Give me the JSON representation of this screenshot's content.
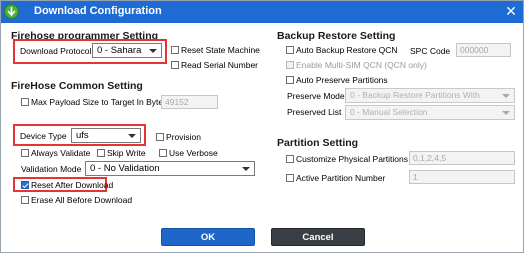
{
  "window": {
    "title": "Download Configuration",
    "close_glyph": "✕"
  },
  "firehose_programmer": {
    "heading": "Firehose programmer Setting",
    "protocol_label": "Download Protocol",
    "protocol_value": "0 - Sahara",
    "reset_state_machine": {
      "label": "Reset State Machine",
      "checked": false
    },
    "read_serial_number": {
      "label": "Read Serial Number",
      "checked": false
    }
  },
  "firehose_common": {
    "heading": "FireHose Common Setting",
    "max_payload": {
      "label": "Max Payload Size to Target In Byte",
      "checked": false,
      "value": "49152"
    },
    "device_type_label": "Device Type",
    "device_type_value": "ufs",
    "provision": {
      "label": "Provision",
      "checked": false
    },
    "always_validate": {
      "label": "Always Validate",
      "checked": false
    },
    "skip_write": {
      "label": "Skip Write",
      "checked": false
    },
    "use_verbose": {
      "label": "Use Verbose",
      "checked": false
    },
    "validation_mode_label": "Validation Mode",
    "validation_mode_value": "0 - No Validation",
    "reset_after_download": {
      "label": "Reset After Download",
      "checked": true
    },
    "erase_all_before_download": {
      "label": "Erase All Before Download",
      "checked": false
    }
  },
  "backup_restore": {
    "heading": "Backup Restore Setting",
    "auto_backup_restore_qcn": {
      "label": "Auto Backup Restore QCN",
      "checked": false
    },
    "spc_code_label": "SPC Code",
    "spc_code_value": "000000",
    "enable_multi_sim": {
      "label": "Enable Multi-SIM QCN (QCN only)",
      "checked": false
    },
    "auto_preserve_partitions": {
      "label": "Auto Preserve Partitions",
      "checked": false
    },
    "preserve_mode_label": "Preserve Mode",
    "preserve_mode_value": "0 - Backup Restore Partitions With",
    "preserved_list_label": "Preserved List",
    "preserved_list_value": "0 - Manual Selection"
  },
  "partition": {
    "heading": "Partition Setting",
    "customize_physical_partitions": {
      "label": "Customize Physical Partitions",
      "checked": false,
      "value": "0,1,2,4,5"
    },
    "active_partition_number": {
      "label": "Active Partition Number",
      "checked": false,
      "value": "1"
    }
  },
  "buttons": {
    "ok": "OK",
    "cancel": "Cancel"
  },
  "colors": {
    "titlebar": "#1e6bd5",
    "highlight": "#e53434",
    "ok_button": "#1f66c9",
    "cancel_button": "#3a3f46"
  }
}
